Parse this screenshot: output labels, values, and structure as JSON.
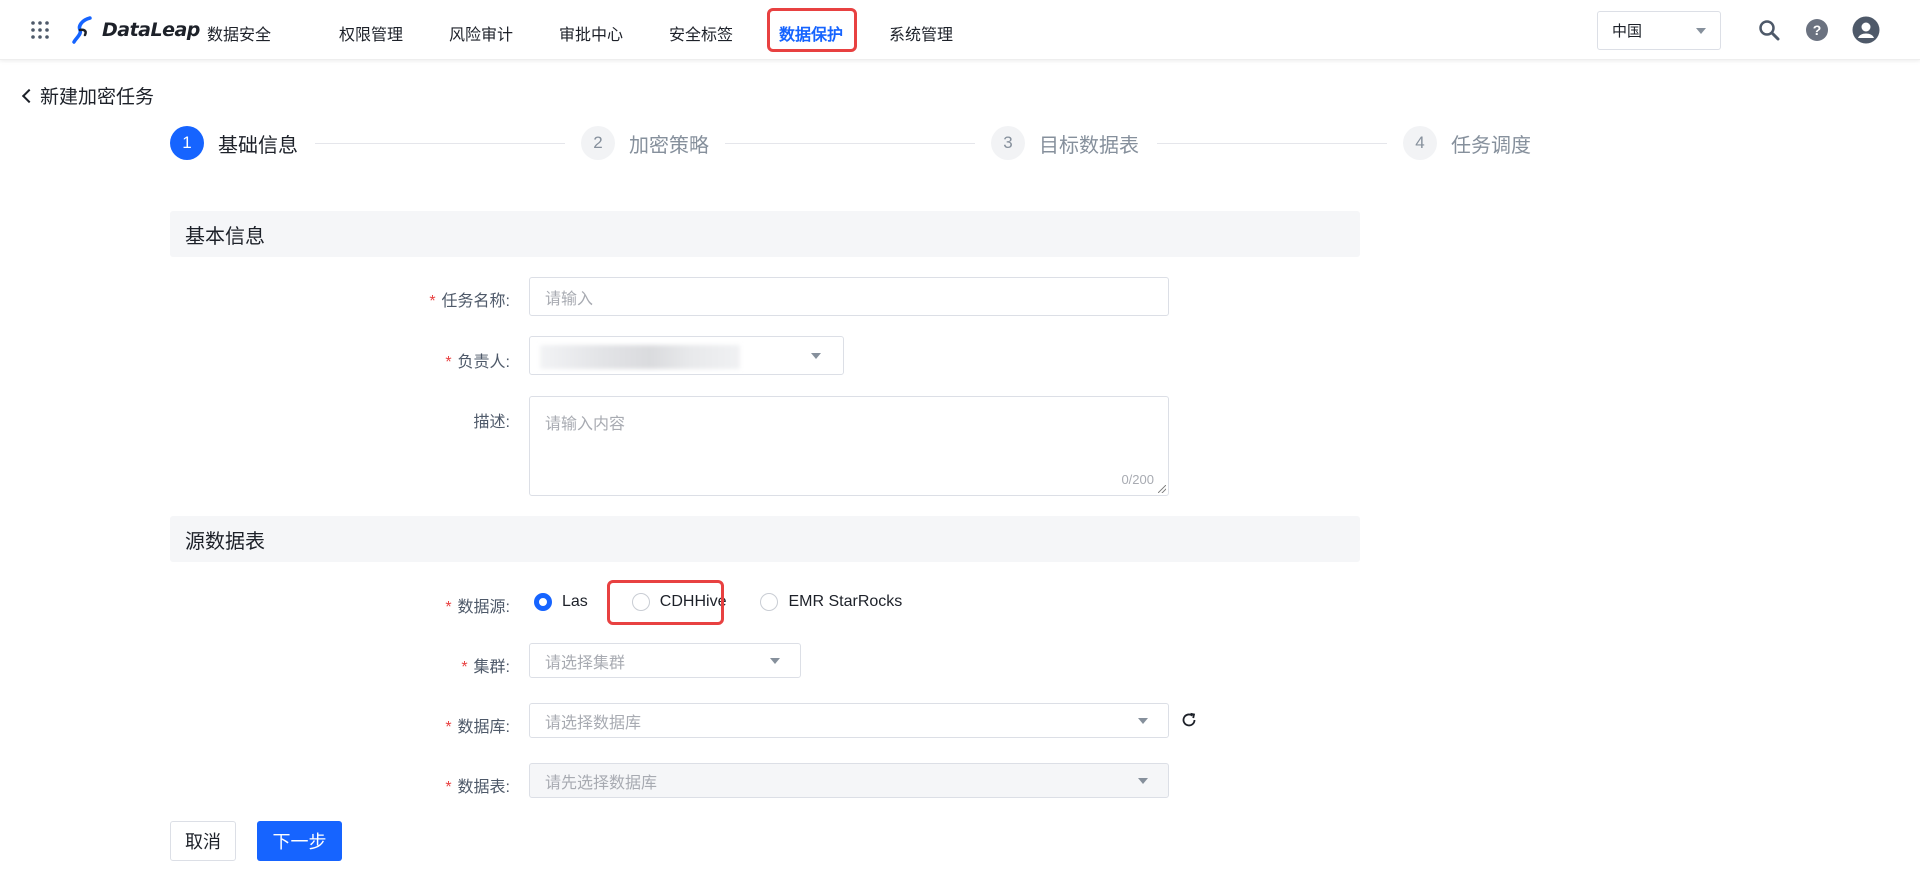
{
  "app": {
    "logo_text": "DataLeap",
    "product_name": "数据安全"
  },
  "nav": {
    "items": [
      {
        "label": "权限管理"
      },
      {
        "label": "风险审计"
      },
      {
        "label": "审批中心"
      },
      {
        "label": "安全标签"
      },
      {
        "label": "数据保护"
      },
      {
        "label": "系统管理"
      }
    ]
  },
  "region": {
    "selected": "中国"
  },
  "page": {
    "title": "新建加密任务"
  },
  "steps": [
    {
      "num": "1",
      "label": "基础信息"
    },
    {
      "num": "2",
      "label": "加密策略"
    },
    {
      "num": "3",
      "label": "目标数据表"
    },
    {
      "num": "4",
      "label": "任务调度"
    }
  ],
  "basic_section": {
    "title": "基本信息",
    "task_name": {
      "label": "任务名称:",
      "placeholder": "请输入"
    },
    "owner": {
      "label": "负责人:"
    },
    "description": {
      "label": "描述:",
      "placeholder": "请输入内容",
      "counter": "0/200"
    }
  },
  "source_section": {
    "title": "源数据表",
    "datasource": {
      "label": "数据源:",
      "options": [
        {
          "label": "Las",
          "checked": true
        },
        {
          "label": "CDHHive",
          "checked": false
        },
        {
          "label": "EMR StarRocks",
          "checked": false
        }
      ]
    },
    "cluster": {
      "label": "集群:",
      "placeholder": "请选择集群"
    },
    "database": {
      "label": "数据库:",
      "placeholder": "请选择数据库"
    },
    "table": {
      "label": "数据表:",
      "placeholder": "请先选择数据库"
    }
  },
  "actions": {
    "cancel": "取消",
    "next": "下一步"
  },
  "colors": {
    "primary": "#1664ff",
    "highlight": "#e84141",
    "required": "#e84141"
  }
}
